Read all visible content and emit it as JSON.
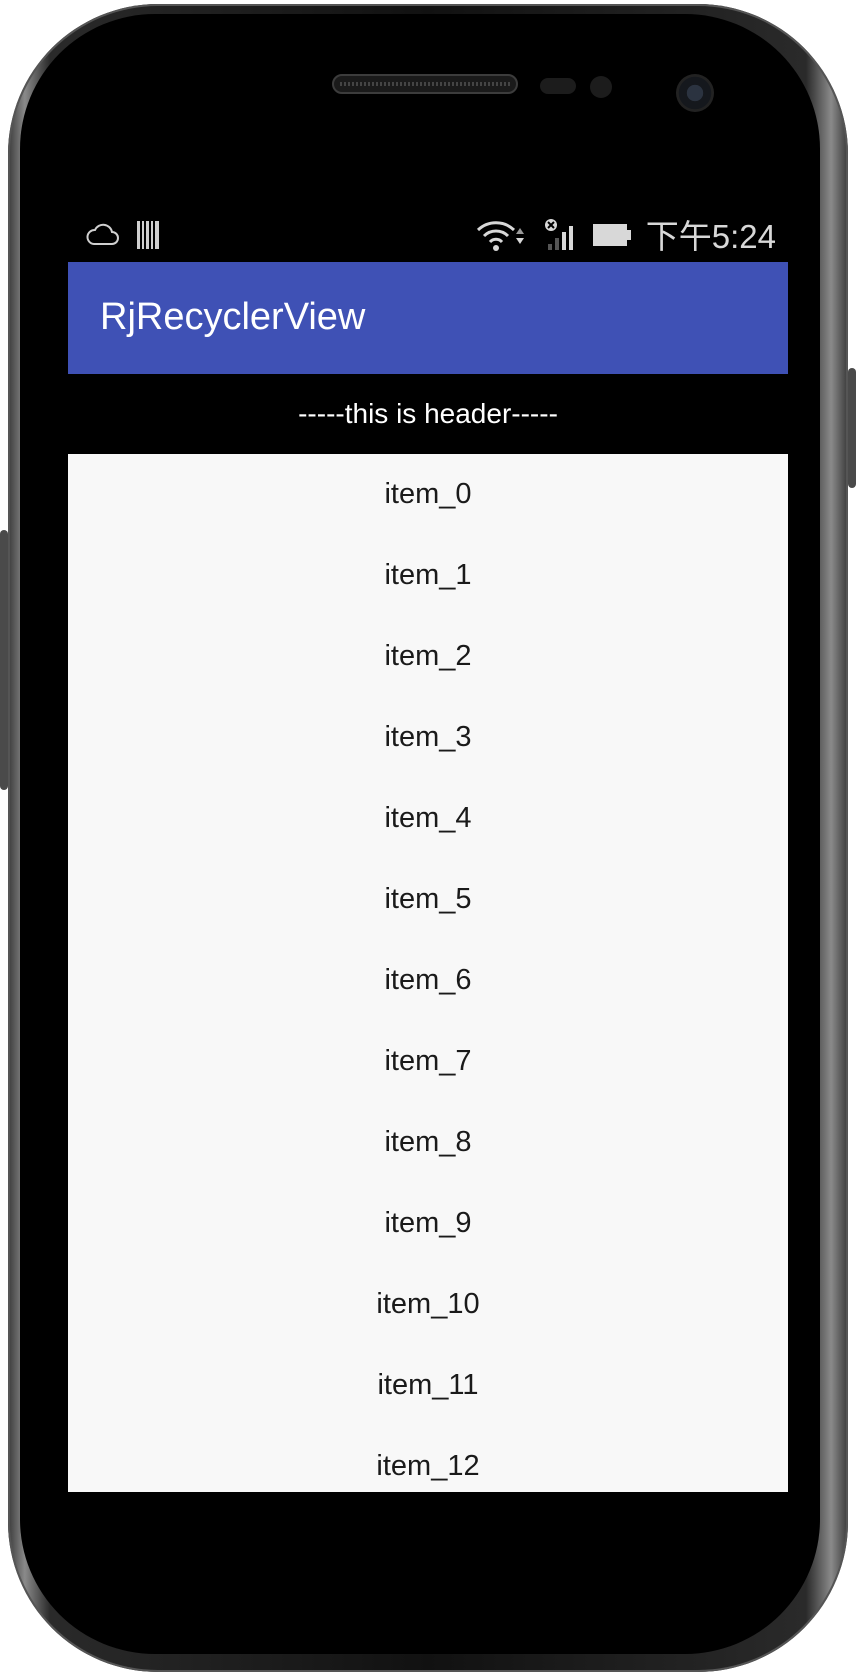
{
  "status_bar": {
    "time": "下午5:24",
    "icons": [
      "cloud-icon",
      "barcode-icon",
      "wifi-icon",
      "data-arrows-icon",
      "no-sim-signal-icon",
      "battery-icon"
    ]
  },
  "app_bar": {
    "title": "RjRecyclerView",
    "color": "#3f51b5"
  },
  "list": {
    "header": "-----this is header-----",
    "items": [
      "item_0",
      "item_1",
      "item_2",
      "item_3",
      "item_4",
      "item_5",
      "item_6",
      "item_7",
      "item_8",
      "item_9",
      "item_10",
      "item_11",
      "item_12"
    ]
  }
}
